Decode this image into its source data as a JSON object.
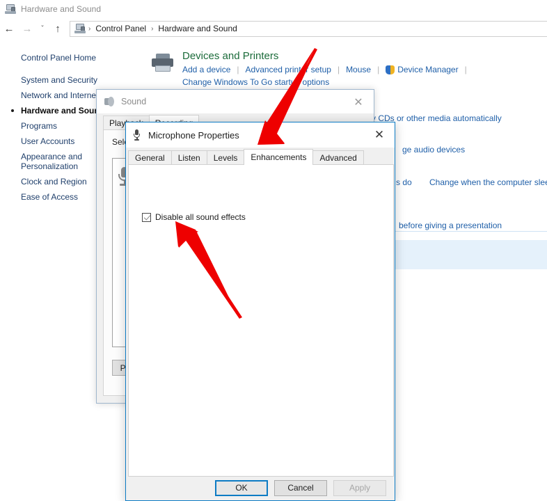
{
  "window": {
    "title": "Hardware and Sound",
    "icon": "hardware-and-sound-icon"
  },
  "nav": {
    "back": "←",
    "forward": "→",
    "recent": "ˇ",
    "up": "↑",
    "breadcrumb": {
      "icon": "control-panel-icon",
      "separator": "›",
      "items": [
        "Control Panel",
        "Hardware and Sound"
      ]
    }
  },
  "sidebar": {
    "home": "Control Panel Home",
    "items": [
      {
        "label": "System and Security",
        "active": false
      },
      {
        "label": "Network and Internet",
        "active": false
      },
      {
        "label": "Hardware and Sound",
        "active": true
      },
      {
        "label": "Programs",
        "active": false
      },
      {
        "label": "User Accounts",
        "active": false
      },
      {
        "label": "Appearance and\nPersonalization",
        "active": false
      },
      {
        "label": "Clock and Region",
        "active": false
      },
      {
        "label": "Ease of Access",
        "active": false
      }
    ]
  },
  "content": {
    "devices_and_printers": {
      "icon": "printer-icon",
      "heading": "Devices and Printers",
      "links_row1": [
        "Add a device",
        "Advanced printer setup",
        "Mouse"
      ],
      "device_manager": {
        "icon": "shield-icon",
        "label": "Device Manager"
      },
      "links_row2": [
        "Change Windows To Go startup options"
      ]
    },
    "background_links": [
      {
        "text": "y CDs or other media automatically"
      },
      {
        "text": "ge audio devices"
      },
      {
        "text": "s do"
      },
      {
        "text": "Change when the computer slee"
      },
      {
        "text": "before giving a presentation"
      }
    ]
  },
  "sound_dialog": {
    "icon": "speaker-icon",
    "title": "Sound",
    "close": "✕",
    "tabs": [
      {
        "label": "Playback",
        "active": false
      },
      {
        "label": "Recording",
        "active": true
      }
    ],
    "select_label": "Select a recording device below to modify its settings:",
    "properties_button": "Properties"
  },
  "mic_properties": {
    "icon": "microphone-icon",
    "title": "Microphone Properties",
    "close": "✕",
    "tabs": [
      {
        "label": "General",
        "active": false
      },
      {
        "label": "Listen",
        "active": false
      },
      {
        "label": "Levels",
        "active": false
      },
      {
        "label": "Enhancements",
        "active": true
      },
      {
        "label": "Advanced",
        "active": false
      }
    ],
    "disable_all_sound_effects": {
      "label": "Disable all sound effects",
      "checked": true
    },
    "buttons": {
      "ok": "OK",
      "cancel": "Cancel",
      "apply": "Apply"
    }
  },
  "annotations": {
    "arrow_color": "#ee0000",
    "arrows": [
      {
        "name": "arrow-to-enhancements-tab",
        "points_to": "Enhancements"
      },
      {
        "name": "arrow-to-disable-effects-checkbox",
        "points_to": "Disable all sound effects"
      }
    ]
  }
}
